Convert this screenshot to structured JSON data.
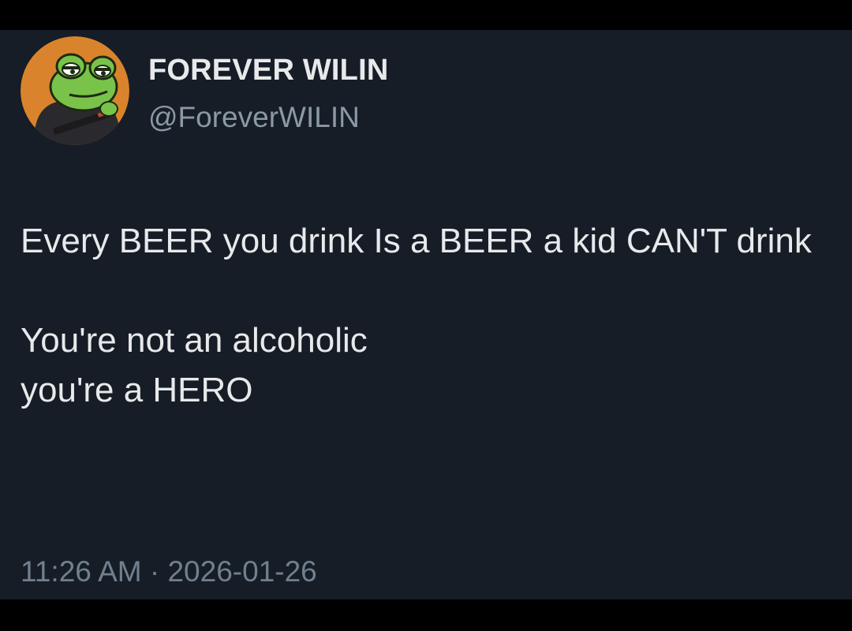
{
  "colors": {
    "page_background": "#000000",
    "card_background": "#161d27",
    "primary_text": "#e7e9ea",
    "secondary_text": "#8b98a5",
    "avatar_background": "#d9842d",
    "avatar_frog_green": "#79c34a"
  },
  "author": {
    "display_name": "FOREVER WILIN",
    "handle": "@ForeverWILIN",
    "avatar_icon": "frog-avatar-icon"
  },
  "tweet": {
    "lines": [
      "Every BEER you drink Is a BEER a kid CAN'T drink",
      "You're not an alcoholic",
      "you're a HERO"
    ]
  },
  "meta": {
    "time": "11:26 AM",
    "separator": "·",
    "date": "2026-01-26"
  }
}
